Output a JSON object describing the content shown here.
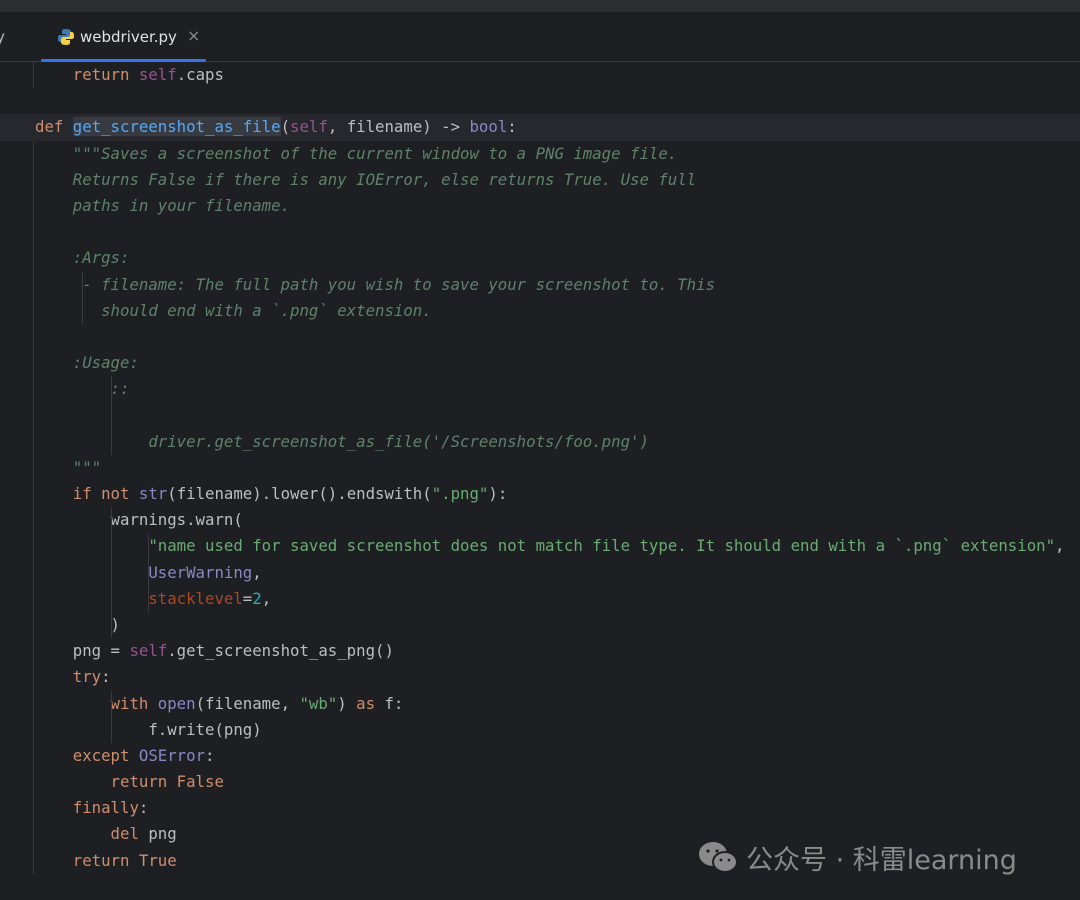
{
  "tabs": [
    {
      "label": "y",
      "active": false
    },
    {
      "label": "webdriver.py",
      "active": true,
      "icon": "python-icon",
      "close": "×"
    }
  ],
  "colors": {
    "accent": "#3574f0",
    "background": "#1e1f22",
    "keyword": "#cf8e6d",
    "function": "#56a8f5",
    "docstring": "#5f826b",
    "string": "#6aab73",
    "builtin": "#8888c6",
    "self": "#94558d",
    "number": "#2aacb8",
    "kwarg": "#aa4926",
    "bulb": "#f2c55c"
  },
  "editor": {
    "current_line": 2,
    "lines": [
      [
        [
          "txt",
          "    "
        ],
        [
          "kw",
          "return "
        ],
        [
          "self",
          "self"
        ],
        [
          "txt",
          ".caps"
        ]
      ],
      [],
      [
        [
          "kw",
          "def "
        ],
        [
          "fn",
          "get_screenshot_as_file"
        ],
        [
          "txt",
          "("
        ],
        [
          "self",
          "self"
        ],
        [
          "txt",
          ", filename) -> "
        ],
        [
          "bi",
          "bool"
        ],
        [
          "txt",
          ":"
        ]
      ],
      [
        [
          "doc",
          "    \"\"\"Saves a screenshot of the current window to a PNG image file."
        ]
      ],
      [
        [
          "doc",
          "    Returns False if there is any IOError, else returns True. Use full"
        ]
      ],
      [
        [
          "doc",
          "    paths in your filename."
        ]
      ],
      [],
      [
        [
          "doc",
          "    :Args:"
        ]
      ],
      [
        [
          "doc",
          "     - filename: The full path you wish to save your screenshot to. This"
        ]
      ],
      [
        [
          "doc",
          "       should end with a `.png` extension."
        ]
      ],
      [],
      [
        [
          "doc",
          "    :Usage:"
        ]
      ],
      [
        [
          "doc",
          "        ::"
        ]
      ],
      [],
      [
        [
          "doc",
          "            driver.get_screenshot_as_file('/Screenshots/foo.png')"
        ]
      ],
      [
        [
          "doc",
          "    \"\"\""
        ]
      ],
      [
        [
          "txt",
          "    "
        ],
        [
          "kw",
          "if not "
        ],
        [
          "bi",
          "str"
        ],
        [
          "txt",
          "(filename).lower().endswith("
        ],
        [
          "str",
          "\".png\""
        ],
        [
          "txt",
          "):"
        ]
      ],
      [
        [
          "txt",
          "        warnings.warn("
        ]
      ],
      [
        [
          "str",
          "            \"name used for saved screenshot does not match file type. It should end with a `.png` extension\""
        ],
        [
          "txt",
          ","
        ]
      ],
      [
        [
          "bi",
          "            UserWarning"
        ],
        [
          "txt",
          ","
        ]
      ],
      [
        [
          "kwarg",
          "            stacklevel"
        ],
        [
          "txt",
          "="
        ],
        [
          "num",
          "2"
        ],
        [
          "txt",
          ","
        ]
      ],
      [
        [
          "txt",
          "        )"
        ]
      ],
      [
        [
          "txt",
          "    png = "
        ],
        [
          "self",
          "self"
        ],
        [
          "txt",
          ".get_screenshot_as_png()"
        ]
      ],
      [
        [
          "kw",
          "    try"
        ],
        [
          "txt",
          ":"
        ]
      ],
      [
        [
          "kw",
          "        with "
        ],
        [
          "bi",
          "open"
        ],
        [
          "txt",
          "(filename, "
        ],
        [
          "str",
          "\"wb\""
        ],
        [
          "txt",
          ") "
        ],
        [
          "kw",
          "as "
        ],
        [
          "txt",
          "f:"
        ]
      ],
      [
        [
          "txt",
          "            f.write(png)"
        ]
      ],
      [
        [
          "kw",
          "    except "
        ],
        [
          "bi",
          "OSError"
        ],
        [
          "txt",
          ":"
        ]
      ],
      [
        [
          "kw",
          "        return False"
        ]
      ],
      [
        [
          "kw",
          "    finally"
        ],
        [
          "txt",
          ":"
        ]
      ],
      [
        [
          "kw",
          "        del "
        ],
        [
          "txt",
          "png"
        ]
      ],
      [
        [
          "kw",
          "    return True"
        ]
      ]
    ]
  },
  "watermark": {
    "text": "公众号 · 科雷learning",
    "icon": "wechat-icon"
  }
}
